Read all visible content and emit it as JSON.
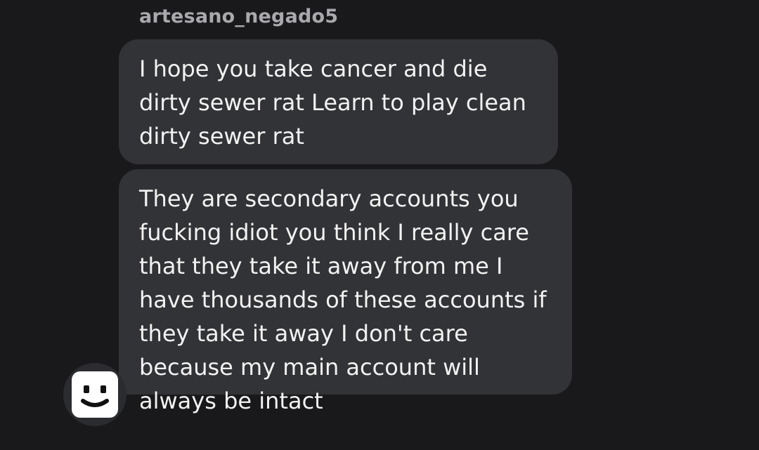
{
  "conversation": {
    "sender": "artesano_negado5",
    "messages": [
      {
        "text": "I hope you take cancer and die dirty sewer rat Learn to play clean dirty sewer rat"
      },
      {
        "text": "They are secondary accounts you fucking idiot you think I really care that they take it away from me I have thousands of these accounts if they take it away I don't care because my main account will always be intact"
      }
    ],
    "avatar_icon": "smiley-face-icon"
  },
  "colors": {
    "background": "#19191b",
    "bubble": "#323336",
    "sender_text": "#a9a9ad",
    "message_text": "#f2f2f2"
  }
}
